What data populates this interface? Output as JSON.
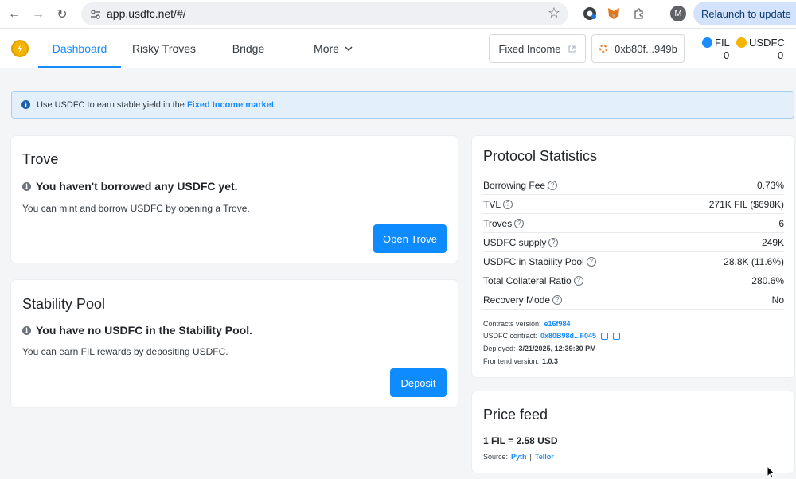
{
  "browser": {
    "url": "app.usdfc.net/#/",
    "relaunch_label": "Relaunch to update",
    "avatar_letter": "M"
  },
  "header": {
    "tabs": [
      {
        "label": "Dashboard",
        "active": true
      },
      {
        "label": "Risky Troves",
        "active": false
      },
      {
        "label": "Bridge",
        "active": false
      },
      {
        "label": "More",
        "active": false
      }
    ],
    "fixed_income_label": "Fixed Income",
    "wallet_address": "0xb80f...949b",
    "balances": [
      {
        "symbol": "FIL",
        "amount": "0",
        "color": "#1a8cff"
      },
      {
        "symbol": "USDFC",
        "amount": "0",
        "color": "#f4b400"
      }
    ]
  },
  "banner": {
    "text_before": "Use USDFC to earn stable yield in the ",
    "link_text": "Fixed Income market",
    "text_after": "."
  },
  "trove": {
    "title": "Trove",
    "notice": "You haven't borrowed any USDFC yet.",
    "subtext": "You can mint and borrow USDFC by opening a Trove.",
    "button": "Open Trove"
  },
  "stability_pool": {
    "title": "Stability Pool",
    "notice": "You have no USDFC in the Stability Pool.",
    "subtext": "You can earn FIL rewards by depositing USDFC.",
    "button": "Deposit"
  },
  "protocol_stats": {
    "title": "Protocol Statistics",
    "rows": [
      {
        "label": "Borrowing Fee",
        "value": "0.73%"
      },
      {
        "label": "TVL",
        "value": "271K FIL ($698K)"
      },
      {
        "label": "Troves",
        "value": "6"
      },
      {
        "label": "USDFC supply",
        "value": "249K"
      },
      {
        "label": "USDFC in Stability Pool",
        "value": "28.8K (11.6%)"
      },
      {
        "label": "Total Collateral Ratio",
        "value": "280.6%"
      },
      {
        "label": "Recovery Mode",
        "value": "No"
      }
    ],
    "contracts_version_label": "Contracts version:",
    "contracts_version": "e16f984",
    "usdfc_contract_label": "USDFC contract:",
    "usdfc_contract": "0x80B98d...F045",
    "deployed_label": "Deployed:",
    "deployed": "3/21/2025, 12:39:30 PM",
    "frontend_version_label": "Frontend version:",
    "frontend_version": "1.0.3"
  },
  "price_feed": {
    "title": "Price feed",
    "price": "1 FIL = 2.58 USD",
    "source_label": "Source:",
    "sources": [
      "Pyth",
      "Tellor"
    ],
    "separator": "|"
  }
}
